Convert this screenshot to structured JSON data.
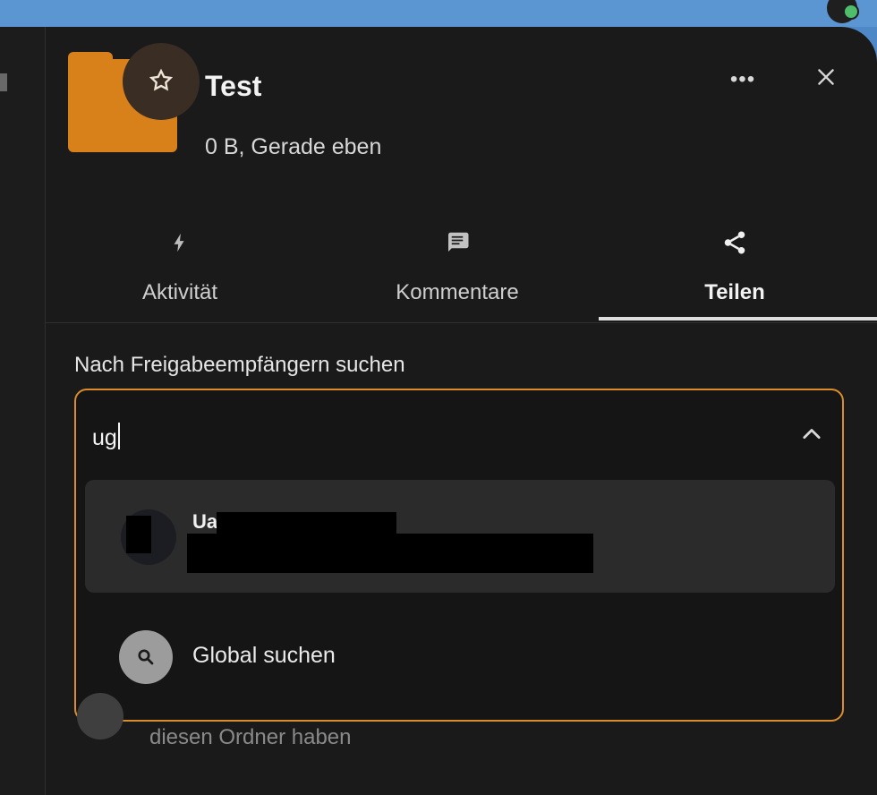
{
  "header": {
    "title": "Test",
    "meta": "0 B, Gerade eben",
    "favorite_icon": "star-icon",
    "more_icon": "more-horizontal-icon",
    "close_icon": "close-icon",
    "folder_color": "#d8811a"
  },
  "tabs": [
    {
      "label": "Aktivität",
      "icon": "lightning-icon",
      "active": false
    },
    {
      "label": "Kommentare",
      "icon": "comment-icon",
      "active": false
    },
    {
      "label": "Teilen",
      "icon": "share-icon",
      "active": true
    }
  ],
  "share": {
    "search_label": "Nach Freigabeempfängern suchen",
    "search_value": "ug",
    "dropdown_icon": "chevron-up-icon",
    "results": [
      {
        "name": "Ua"
      }
    ],
    "global_search": {
      "label": "Global suchen",
      "icon": "search-icon"
    },
    "background_text": "diesen Ordner haben",
    "focus_color": "#db8d2c"
  }
}
